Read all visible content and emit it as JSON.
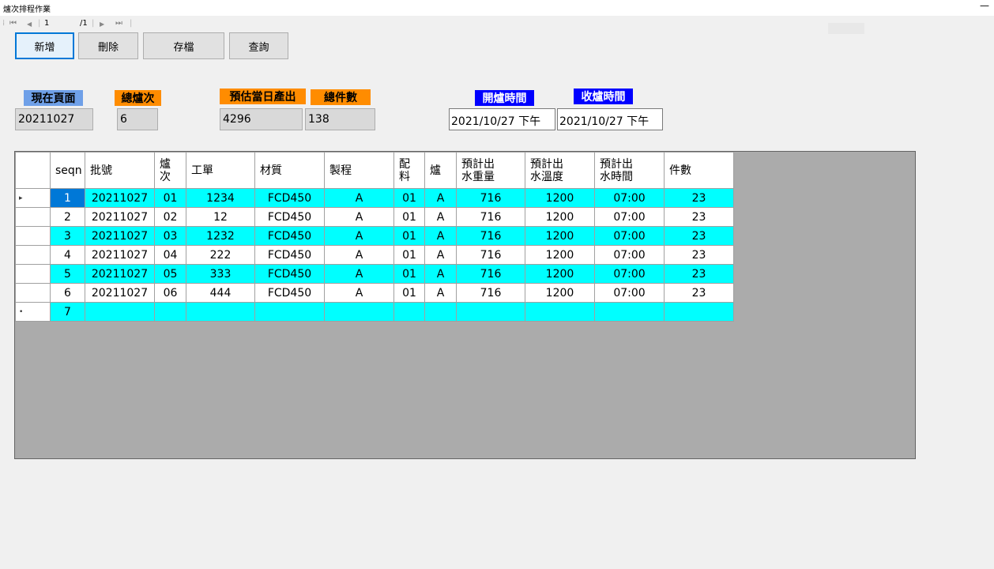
{
  "window": {
    "title": "爐次排程作業",
    "minimize_glyph": "—"
  },
  "navigator": {
    "first_icon": "⏮",
    "prev_icon": "◀",
    "position": "1",
    "total": "/1",
    "next_icon": "▶",
    "last_icon": "⏭"
  },
  "toolbar": {
    "add": "新增",
    "delete": "刪除",
    "save": "存檔",
    "query": "查詢"
  },
  "fields": {
    "current_page_label": "現在頁面",
    "current_page_value": "20211027",
    "total_heats_label": "總爐次",
    "total_heats_value": "6",
    "est_output_label": "預估當日產出",
    "est_output_value": "4296",
    "total_pieces_label": "總件數",
    "total_pieces_value": "138",
    "open_time_label": "開爐時間",
    "open_time_value": "2021/10/27 下午",
    "close_time_label": "收爐時間",
    "close_time_value": "2021/10/27 下午"
  },
  "colors": {
    "cyan_row": "#00ffff",
    "selected": "#0078d7",
    "label_orange": "#ff8c00",
    "label_navy": "#0000ff",
    "label_blue": "#6fa0e8"
  },
  "grid": {
    "headers": {
      "seqn": "seqn",
      "batch": "批號",
      "heat_1": "爐",
      "heat_2": "次",
      "work_order": "工單",
      "material": "材質",
      "process": "製程",
      "mix_1": "配",
      "mix_2": "料",
      "furnace": "爐",
      "weight_1": "預計出",
      "weight_2": "水重量",
      "temp_1": "預計出",
      "temp_2": "水溫度",
      "time_1": "預計出",
      "time_2": "水時間",
      "pieces": "件數"
    },
    "current_row_marker": "▸",
    "new_row_marker": "•",
    "rows": [
      {
        "seqn": "1",
        "batch": "20211027",
        "heat": "01",
        "work_order": "1234",
        "material": "FCD450",
        "process": "A",
        "mix": "01",
        "furnace": "A",
        "weight": "716",
        "temp": "1200",
        "time": "07:00",
        "pieces": "23"
      },
      {
        "seqn": "2",
        "batch": "20211027",
        "heat": "02",
        "work_order": "12",
        "material": "FCD450",
        "process": "A",
        "mix": "01",
        "furnace": "A",
        "weight": "716",
        "temp": "1200",
        "time": "07:00",
        "pieces": "23"
      },
      {
        "seqn": "3",
        "batch": "20211027",
        "heat": "03",
        "work_order": "1232",
        "material": "FCD450",
        "process": "A",
        "mix": "01",
        "furnace": "A",
        "weight": "716",
        "temp": "1200",
        "time": "07:00",
        "pieces": "23"
      },
      {
        "seqn": "4",
        "batch": "20211027",
        "heat": "04",
        "work_order": "222",
        "material": "FCD450",
        "process": "A",
        "mix": "01",
        "furnace": "A",
        "weight": "716",
        "temp": "1200",
        "time": "07:00",
        "pieces": "23"
      },
      {
        "seqn": "5",
        "batch": "20211027",
        "heat": "05",
        "work_order": "333",
        "material": "FCD450",
        "process": "A",
        "mix": "01",
        "furnace": "A",
        "weight": "716",
        "temp": "1200",
        "time": "07:00",
        "pieces": "23"
      },
      {
        "seqn": "6",
        "batch": "20211027",
        "heat": "06",
        "work_order": "444",
        "material": "FCD450",
        "process": "A",
        "mix": "01",
        "furnace": "A",
        "weight": "716",
        "temp": "1200",
        "time": "07:00",
        "pieces": "23"
      }
    ],
    "new_row": {
      "seqn": "7"
    }
  }
}
